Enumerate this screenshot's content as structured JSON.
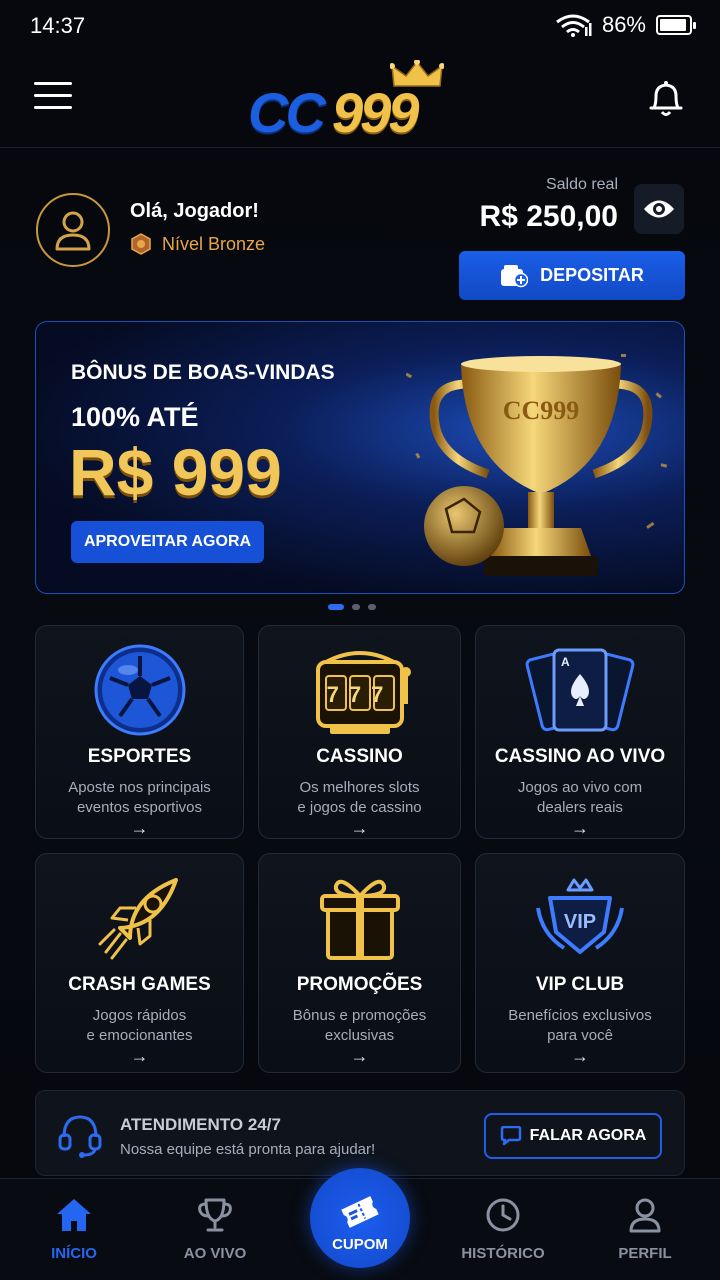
{
  "status": {
    "time": "14:37",
    "battery": "86%"
  },
  "header": {
    "logo_prefix": "CC",
    "logo_number": "999"
  },
  "profile": {
    "greeting": "Olá, Jogador!",
    "level": "Nível Bronze",
    "balance_label": "Saldo real",
    "balance": "R$ 250,00",
    "deposit_label": "DEPOSITAR"
  },
  "banner": {
    "line1": "BÔNUS DE BOAS-VINDAS",
    "line2": "100% ATÉ",
    "amount": "R$ 999",
    "cta": "APROVEITAR AGORA",
    "trophy_text": "CC999",
    "slides": 3,
    "active_slide": 1
  },
  "tiles": [
    {
      "title": "ESPORTES",
      "desc": "Aposte nos principais\neventos esportivos",
      "icon": "soccer-ball-icon"
    },
    {
      "title": "CASSINO",
      "desc": "Os melhores slots\ne jogos de cassino",
      "icon": "slot-machine-icon",
      "reels": "777"
    },
    {
      "title": "CASSINO AO VIVO",
      "desc": "Jogos ao vivo com\ndealers reais",
      "icon": "playing-cards-icon"
    },
    {
      "title": "CRASH GAMES",
      "desc": "Jogos rápidos\ne emocionantes",
      "icon": "rocket-icon"
    },
    {
      "title": "PROMOÇÕES",
      "desc": "Bônus e promoções\nexclusivas",
      "icon": "gift-icon"
    },
    {
      "title": "VIP CLUB",
      "desc": "Benefícios exclusivos\npara você",
      "icon": "vip-crest-icon",
      "badge": "VIP"
    }
  ],
  "tile_arrow": "→",
  "support": {
    "title": "ATENDIMENTO 24/7",
    "desc": "Nossa equipe está pronta para ajudar!",
    "button": "FALAR AGORA"
  },
  "nav": [
    {
      "label": "INÍCIO",
      "icon": "home-icon",
      "active": true
    },
    {
      "label": "AO VIVO",
      "icon": "trophy-icon"
    },
    {
      "label": "CUPOM",
      "icon": "ticket-icon"
    },
    {
      "label": "HISTÓRICO",
      "icon": "clock-icon"
    },
    {
      "label": "PERFIL",
      "icon": "user-icon"
    }
  ],
  "colors": {
    "accent": "#1a5ee8",
    "gold": "#f2c75a",
    "bronze": "#e8a54a",
    "background": "#05070c"
  }
}
